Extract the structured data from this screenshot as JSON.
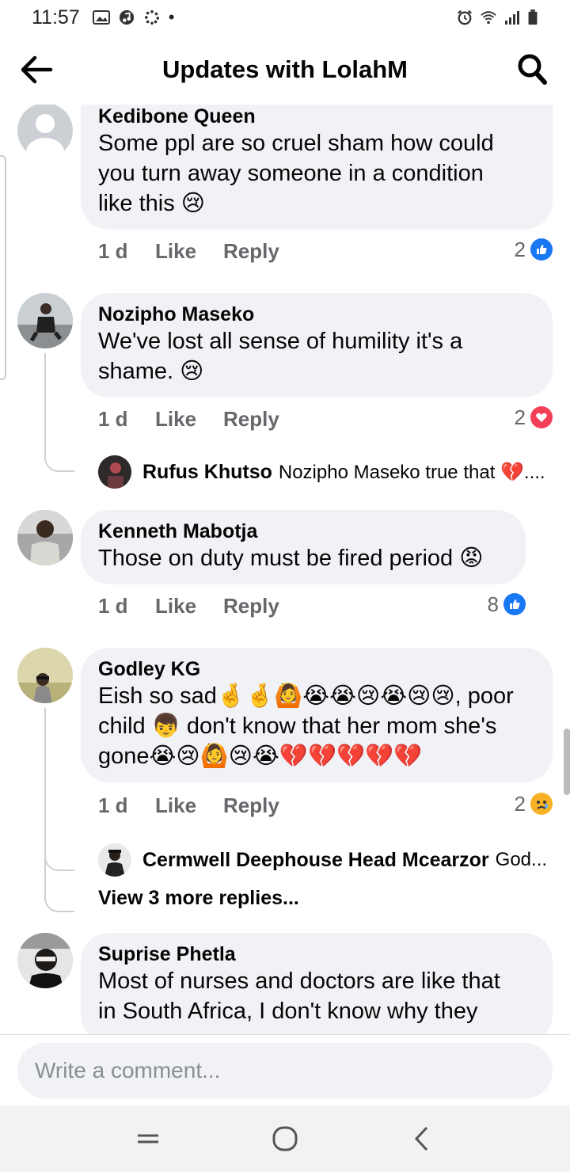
{
  "status_bar": {
    "time": "11:57"
  },
  "header": {
    "title": "Updates with LolahM"
  },
  "comments": [
    {
      "author": "Kedibone Queen",
      "lines": [
        "Some ppl are so cruel sham how could",
        "you turn away someone in a condition",
        "like this 😢"
      ],
      "age": "1 d",
      "like_label": "Like",
      "reply_label": "Reply",
      "reaction_count": "2",
      "reaction_icon": "like-icon"
    },
    {
      "author": "Nozipho Maseko",
      "lines": [
        "We've lost all sense of humility it's a",
        "shame. 😢"
      ],
      "age": "1 d",
      "like_label": "Like",
      "reply_label": "Reply",
      "reaction_count": "2",
      "reaction_icon": "love-icon",
      "reply": {
        "author": "Rufus Khutso",
        "text": "Nozipho Maseko true that 💔...."
      }
    },
    {
      "author": "Kenneth Mabotja",
      "lines": [
        "Those on duty must be fired period 😡"
      ],
      "age": "1 d",
      "like_label": "Like",
      "reply_label": "Reply",
      "reaction_count": "8",
      "reaction_icon": "like-icon"
    },
    {
      "author": "Godley KG",
      "lines": [
        "Eish so sad🤞🤞🙆😭😭😢😭😢😢, poor",
        "child 👦 don't know that her mom she's",
        "gone😭😢🙆😢😭💔💔💔💔💔"
      ],
      "age": "1 d",
      "like_label": "Like",
      "reply_label": "Reply",
      "reaction_count": "2",
      "reaction_icon": "sad-icon",
      "reply": {
        "author": "Cermwell Deephouse Head Mcearzor",
        "text": "God..."
      },
      "view_more": "View 3 more replies..."
    },
    {
      "author": "Suprise Phetla",
      "lines": [
        "Most of nurses and doctors are like that",
        "in South Africa, I don't know why they"
      ]
    }
  ],
  "composer": {
    "placeholder": "Write a comment..."
  },
  "colors": {
    "like_blue": "#1877f2",
    "love_red": "#f33e58",
    "sad_yellow": "#f7b125",
    "bubble_bg": "#f0f2f5",
    "meta_gray": "#65676b"
  }
}
